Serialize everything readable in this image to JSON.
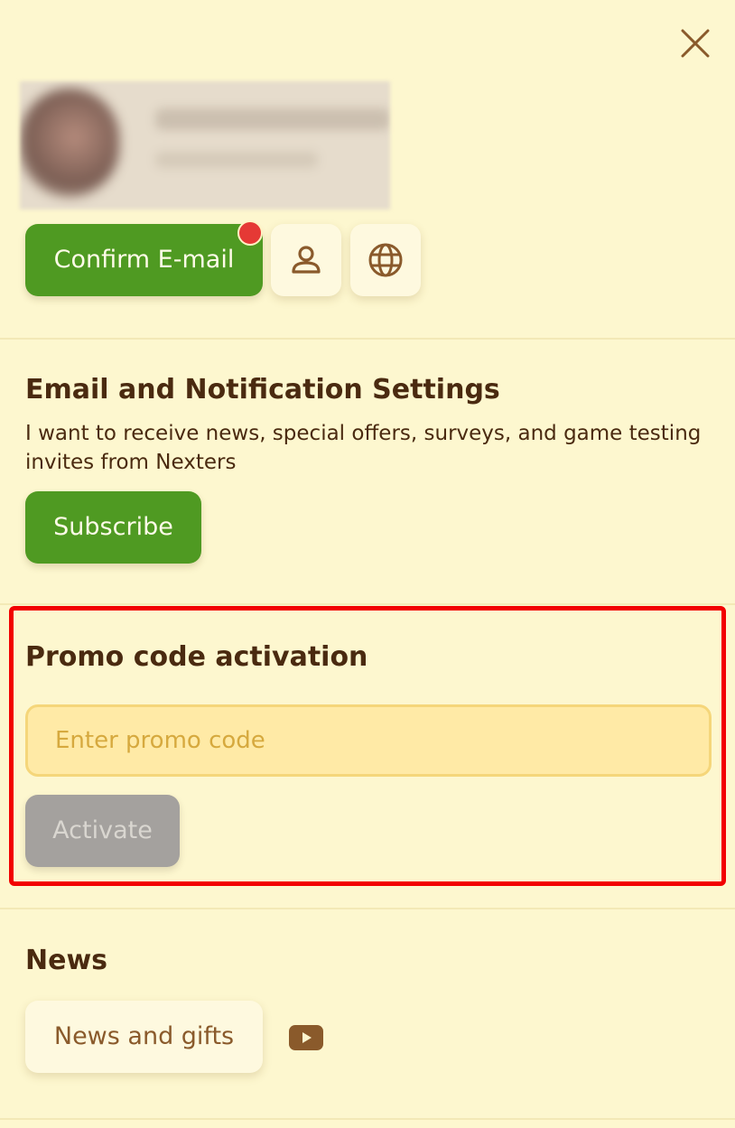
{
  "header": {
    "close_icon": "close-icon"
  },
  "profile": {
    "avatar_icon": "avatar",
    "confirm_email_label": "Confirm E-mail",
    "profile_icon": "user-icon",
    "language_icon": "globe-icon"
  },
  "email_settings": {
    "title": "Email and Notification Settings",
    "description": "I want to receive news, special offers, surveys, and game testing invites from Nexters",
    "subscribe_label": "Subscribe"
  },
  "promo": {
    "title": "Promo code activation",
    "placeholder": "Enter promo code",
    "value": "",
    "activate_label": "Activate"
  },
  "news": {
    "title": "News",
    "news_button_label": "News and gifts",
    "youtube_icon": "youtube-icon"
  },
  "colors": {
    "background": "#fdf7cf",
    "primary_green": "#4f9a22",
    "text_brown": "#4a2a10",
    "icon_brown": "#8a5a2b",
    "badge_red": "#e53935",
    "highlight_red": "#f20000",
    "disabled_gray": "#a4a19e"
  }
}
